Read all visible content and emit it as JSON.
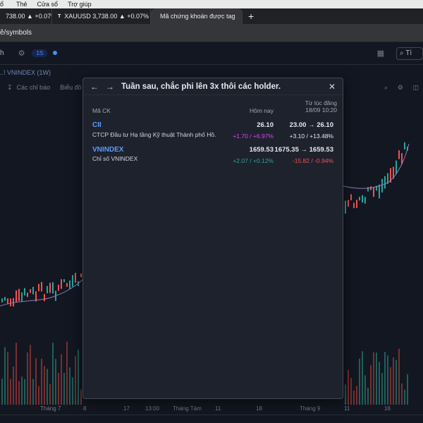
{
  "menubar": {
    "items": [
      "ổ",
      "Thẻ",
      "Cửa sổ",
      "Trợ giúp"
    ]
  },
  "tabs": [
    {
      "label": "738.00 ▲ +0.07%",
      "active": false
    },
    {
      "label": "XAUUSD 3,738.00 ▲ +0.07%",
      "active": false
    },
    {
      "label": "Mã chứng khoán được tag",
      "active": true
    }
  ],
  "url": "ê/symbols",
  "toolbar": {
    "left_text": "h",
    "interval_pill": "1S",
    "search_text": "Tì"
  },
  "chart_header": {
    "title": "..! VNINDEX (1W)"
  },
  "chart_toolbar": {
    "indicators": "Các chỉ báo",
    "alerts": "Biểu đồ"
  },
  "axis_labels": [
    {
      "text": "Tháng 7"
    },
    {
      "text": "8"
    },
    {
      "text": "17"
    },
    {
      "text": "13:00"
    },
    {
      "text": "Tháng Tám"
    },
    {
      "text": "11"
    },
    {
      "text": "18"
    },
    {
      "text": "Tháng 9"
    },
    {
      "text": "11"
    },
    {
      "text": "16"
    }
  ],
  "modal": {
    "title": "Tuần sau, chắc phi lên 3x thôi các holder.",
    "col_symbol": "Mã CK",
    "col_today": "Hôm nay",
    "col_since_1": "Từ lúc đăng",
    "col_since_2": "18/09 10:20",
    "rows": [
      {
        "symbol": "CII",
        "name": "CTCP Đầu tư Hạ tầng Kỹ thuật Thành phố Hồ...",
        "price": "26.10",
        "change_today": "+1.70 / +6.97%",
        "since_price": "23.00 → 26.10",
        "since_change": "+3.10 / +13.48%"
      },
      {
        "symbol": "VNINDEX",
        "name": "Chỉ số VNINDEX",
        "price": "1659.53",
        "change_today": "+2.07 / +0.12%",
        "since_price": "1675.35 → 1659.53",
        "since_change": "-15.82 / -0.94%"
      }
    ]
  },
  "colors": {
    "background": "#131722",
    "modal_bg": "#1e222d",
    "symbol_blue": "#5b9cf6",
    "up_magenta": "#e040fb",
    "up_green": "#26a69a",
    "down_red": "#ef5350"
  }
}
